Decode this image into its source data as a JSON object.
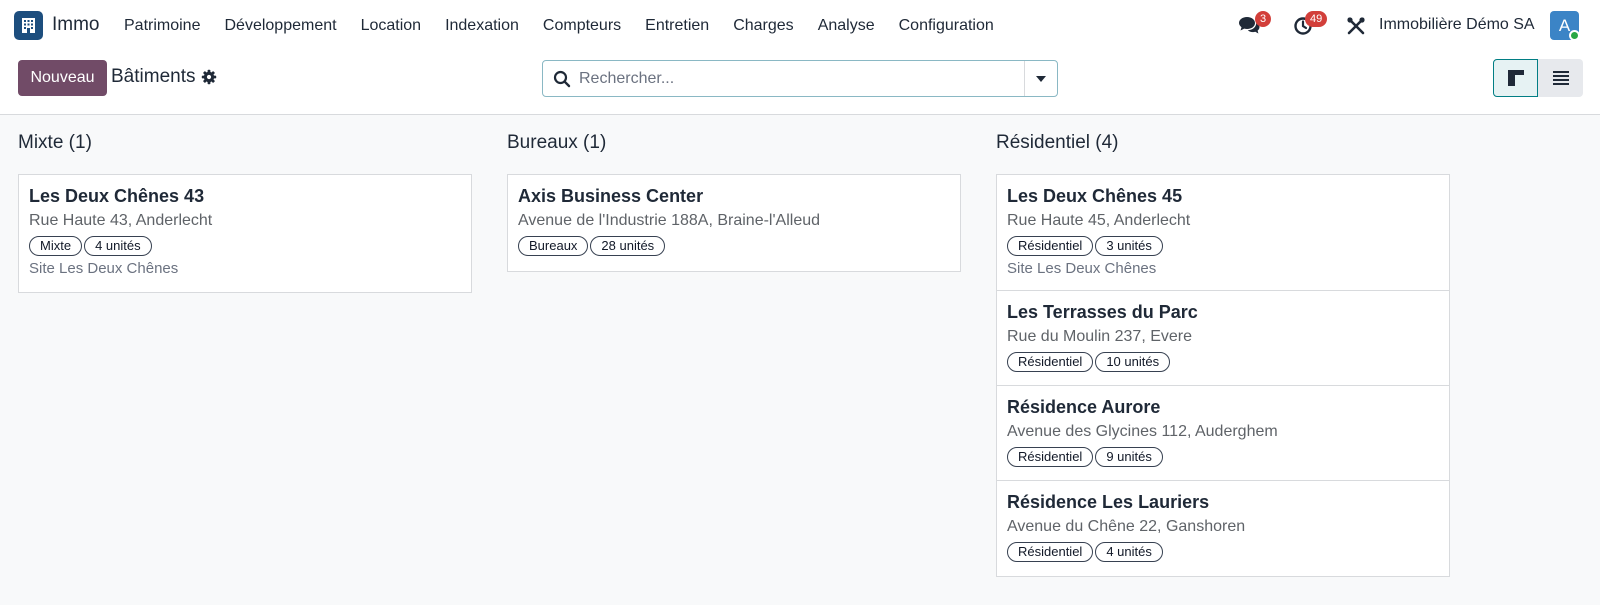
{
  "app": {
    "name": "Immo",
    "logo_icon": "building-icon",
    "brand_color": "#714b67"
  },
  "menu": [
    "Patrimoine",
    "Développement",
    "Location",
    "Indexation",
    "Compteurs",
    "Entretien",
    "Charges",
    "Analyse",
    "Configuration"
  ],
  "systray": {
    "messages_count": "3",
    "activities_count": "49",
    "company": "Immobilière Démo SA",
    "avatar_letter": "A"
  },
  "control": {
    "new_label": "Nouveau",
    "title": "Bâtiments",
    "search_placeholder": "Rechercher..."
  },
  "columns": [
    {
      "title": "Mixte (1)",
      "cards": [
        {
          "name": "Les Deux Chênes 43",
          "address": "Rue Haute 43, Anderlecht",
          "type": "Mixte",
          "units": "4 unités",
          "site": "Site Les Deux Chênes"
        }
      ]
    },
    {
      "title": "Bureaux (1)",
      "cards": [
        {
          "name": "Axis Business Center",
          "address": "Avenue de l'Industrie 188A, Braine-l'Alleud",
          "type": "Bureaux",
          "units": "28 unités",
          "site": ""
        }
      ]
    },
    {
      "title": "Résidentiel (4)",
      "cards": [
        {
          "name": "Les Deux Chênes 45",
          "address": "Rue Haute 45, Anderlecht",
          "type": "Résidentiel",
          "units": "3 unités",
          "site": "Site Les Deux Chênes"
        },
        {
          "name": "Les Terrasses du Parc",
          "address": "Rue du Moulin 237, Evere",
          "type": "Résidentiel",
          "units": "10 unités",
          "site": ""
        },
        {
          "name": "Résidence Aurore",
          "address": "Avenue des Glycines 112, Auderghem",
          "type": "Résidentiel",
          "units": "9 unités",
          "site": ""
        },
        {
          "name": "Résidence Les Lauriers",
          "address": "Avenue du Chêne 22, Ganshoren",
          "type": "Résidentiel",
          "units": "4 unités",
          "site": ""
        }
      ]
    }
  ]
}
